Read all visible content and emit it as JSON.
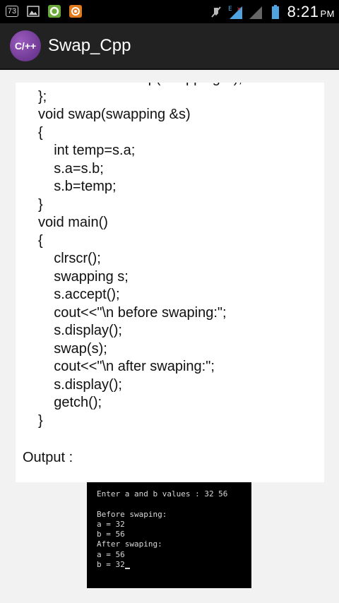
{
  "status_bar": {
    "notification_badge": "73",
    "time": "8:21",
    "ampm": "PM",
    "icons": [
      "notification-count-icon",
      "image-icon",
      "circle-app-icon",
      "orange-app-icon",
      "mute-icon",
      "data-4g-icon",
      "signal-icon",
      "battery-icon"
    ]
  },
  "app_bar": {
    "logo_text": "C/++",
    "title": "Swap_Cpp"
  },
  "code": {
    "lines": [
      "    friend void swap(swapping &);",
      "};",
      "void swap(swapping &s)",
      "{",
      "    int temp=s.a;",
      "    s.a=s.b;",
      "    s.b=temp;",
      "}",
      "void main()",
      "{",
      "    clrscr();",
      "    swapping s;",
      "    s.accept();",
      "    cout<<\"\\n before swaping:\";",
      "    s.display();",
      "    swap(s);",
      "    cout<<\"\\n after swaping:\";",
      "    s.display();",
      "    getch();",
      "}"
    ],
    "output_label": "Output :"
  },
  "console": {
    "lines": [
      "Enter a and b values : 32 56",
      "",
      "Before swaping:",
      "a = 32",
      "b = 56",
      "After swaping:",
      "a = 56",
      "b = 32"
    ]
  },
  "colors": {
    "status_bar_bg": "#000000",
    "app_bar_bg": "#222222",
    "logo_purple": "#7b3fa0",
    "page_bg": "#f2f2f2",
    "console_bg": "#000000"
  }
}
